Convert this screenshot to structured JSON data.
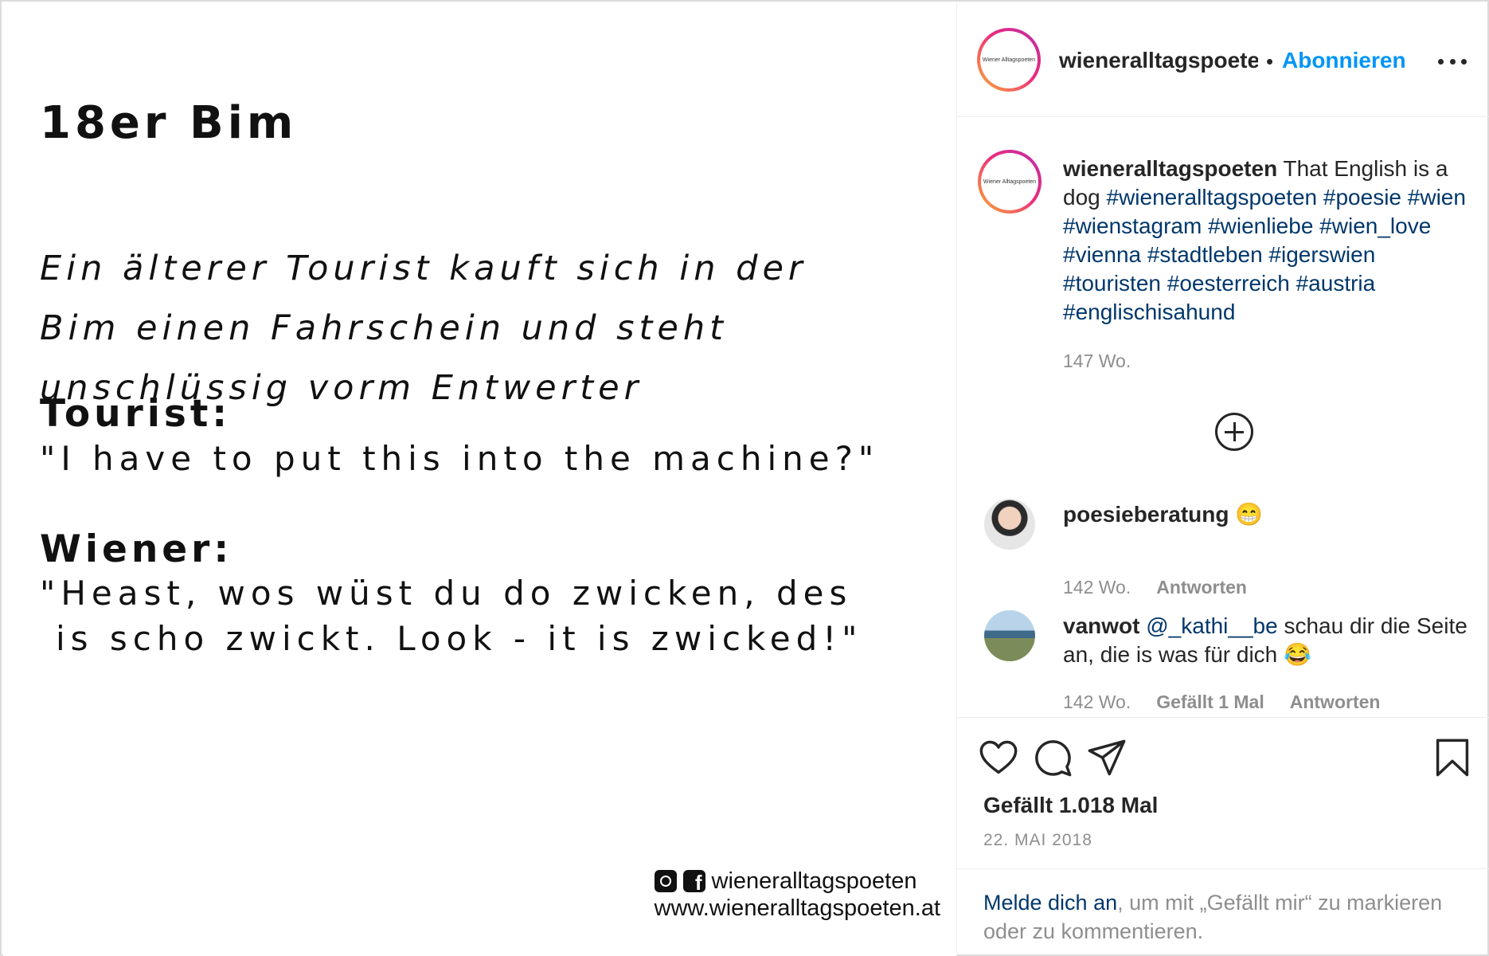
{
  "image": {
    "title": "18er Bim",
    "intro_lines": [
      "Ein älterer Tourist kauft sich in der",
      "Bim einen Fahrschein und steht",
      "unschlüssig vorm Entwerter"
    ],
    "speaker1": "Tourist:",
    "quote1": "\"I have to put this into the machine?\"",
    "speaker2": "Wiener:",
    "quote2_line1": "\"Heast, wos wüst du do zwicken, des",
    "quote2_line2": "is scho zwickt. Look - it is zwicked!\"",
    "footer_handle": "wieneralltagspoeten",
    "footer_url": "www.wieneralltagspoeten.at"
  },
  "header": {
    "avatar_label": "Wiener Alltagspoeten",
    "username": "wieneralltagspoeten",
    "dot": "•",
    "follow_label": "Abonnieren"
  },
  "caption": {
    "username": "wieneralltagspoeten",
    "text": "That English is a dog",
    "hashtags": "#wieneralltagspoeten #poesie #wien #wienstagram #wienliebe #wien_love #vienna #stadtleben #igerswien #touristen #oesterreich #austria #englischisahund",
    "time": "147 Wo."
  },
  "comments": [
    {
      "username": "poesieberatung",
      "text": "😁",
      "time": "142 Wo.",
      "reply_label": "Antworten"
    },
    {
      "username": "vanwot",
      "mention": "@_kathi__be",
      "text": "schau dir die Seite an, die is was für dich 😂",
      "time": "142 Wo.",
      "likes_label": "Gefällt 1 Mal",
      "reply_label": "Antworten"
    }
  ],
  "actions": {
    "icons": [
      "heart-icon",
      "comment-icon",
      "share-icon",
      "bookmark-icon"
    ],
    "likes": "Gefällt 1.018 Mal",
    "date": "22. MAI 2018"
  },
  "login": {
    "link": "Melde dich an",
    "text": ", um mit „Gefällt mir“ zu markieren oder zu kommentieren."
  },
  "colors": {
    "accent": "#0095f6",
    "link": "#00376b",
    "secondary_text": "#8e8e8e"
  }
}
